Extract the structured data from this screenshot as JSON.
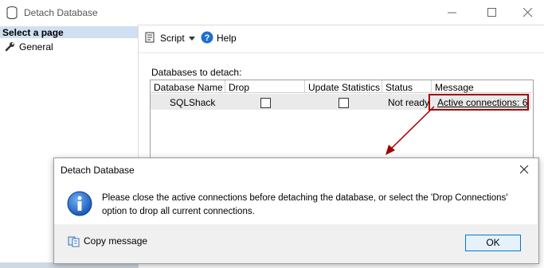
{
  "window": {
    "title": "Detach Database"
  },
  "left_pane": {
    "header": "Select a page",
    "items": [
      {
        "label": "General",
        "icon": "wrench-icon"
      }
    ]
  },
  "toolbar": {
    "script_label": "Script",
    "help_label": "Help"
  },
  "main": {
    "databases_label": "Databases to detach:",
    "columns": [
      "Database Name",
      "Drop Connections",
      "Update Statistics",
      "Status",
      "Message"
    ],
    "rows": [
      {
        "database_name": "SQLShack",
        "drop_connections": false,
        "update_statistics": false,
        "status": "Not ready",
        "message": "Active connections: 6"
      }
    ]
  },
  "dialog": {
    "title": "Detach Database",
    "message_line1": "Please close the active connections before detaching the database, or select the 'Drop Connections'",
    "message_line2": "option to drop all current connections.",
    "copy_label": "Copy message",
    "ok_label": "OK"
  },
  "colors": {
    "highlight": "#a00000",
    "selected_bg": "#cfe0f1",
    "ok_border": "#0078d7"
  }
}
